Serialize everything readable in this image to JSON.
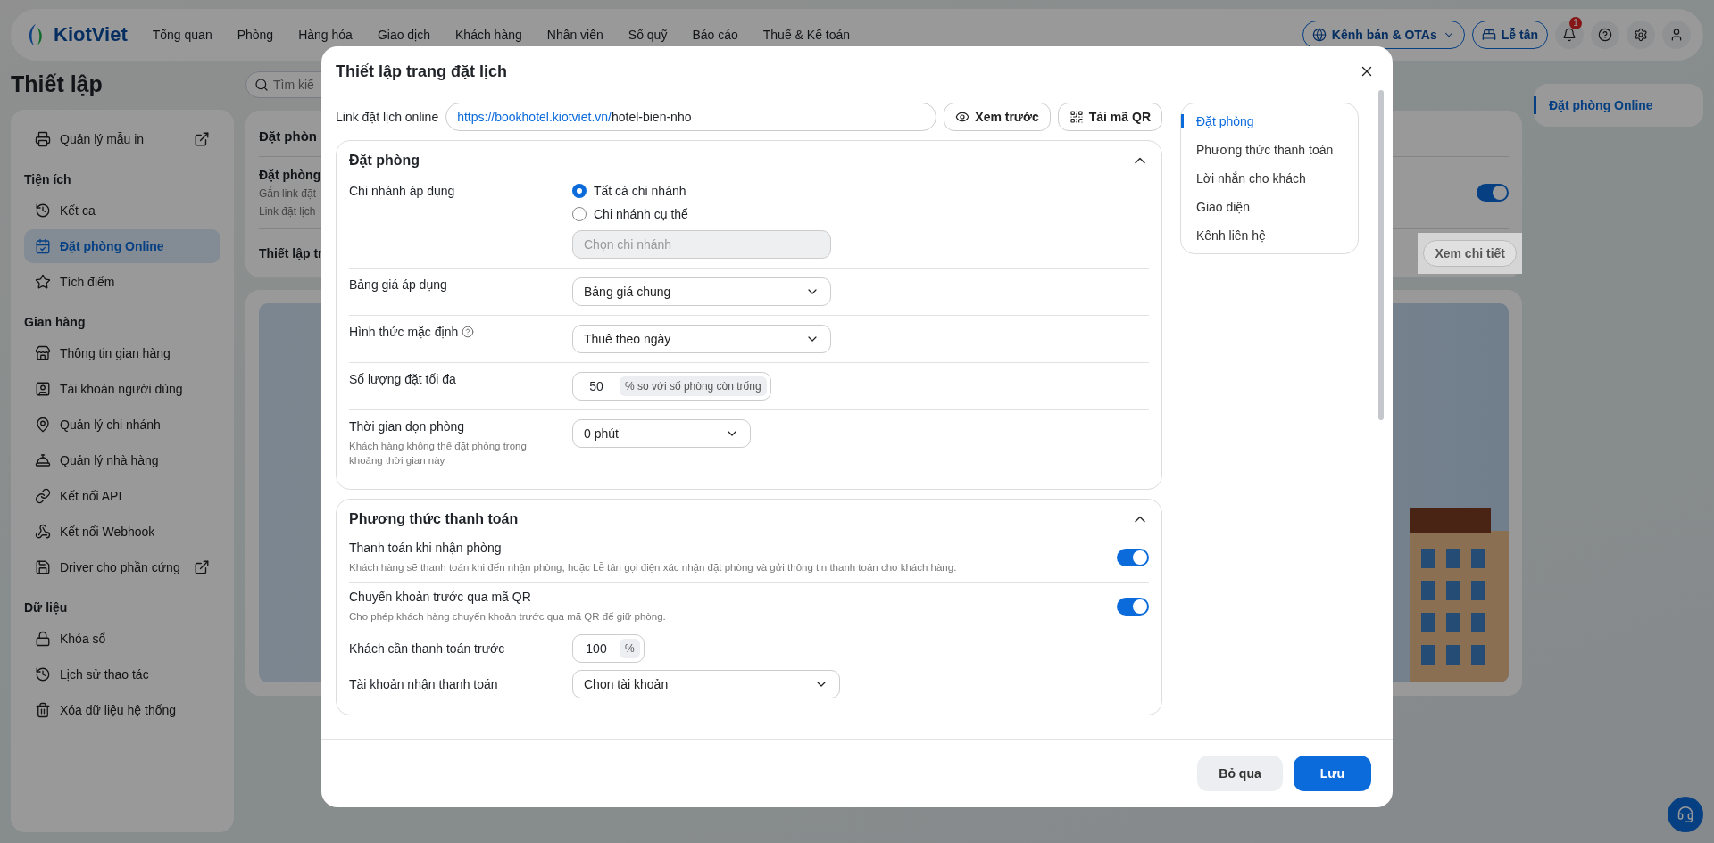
{
  "nav": {
    "logo": "KiotViet",
    "items": [
      "Tổng quan",
      "Phòng",
      "Hàng hóa",
      "Giao dịch",
      "Khách hàng",
      "Nhân viên",
      "Sổ quỹ",
      "Báo cáo",
      "Thuế & Kế toán"
    ],
    "channel_button": "Kênh bán & OTAs",
    "reception_button": "Lễ tân",
    "notification_count": "1"
  },
  "page": {
    "title": "Thiết lập",
    "search_placeholder": "Tìm kiế"
  },
  "sidebar": {
    "sections": [
      {
        "items": [
          {
            "label": "Quản lý mẫu in",
            "selected": false,
            "external": true
          }
        ]
      },
      {
        "heading": "Tiện ích",
        "items": [
          {
            "label": "Kết ca",
            "selected": false,
            "external": false
          },
          {
            "label": "Đặt phòng Online",
            "selected": true,
            "external": false
          },
          {
            "label": "Tích điểm",
            "selected": false,
            "external": false
          }
        ]
      },
      {
        "heading": "Gian hàng",
        "items": [
          {
            "label": "Thông tin gian hàng",
            "selected": false,
            "external": false
          },
          {
            "label": "Tài khoản người dùng",
            "selected": false,
            "external": false
          },
          {
            "label": "Quản lý chi nhánh",
            "selected": false,
            "external": false
          },
          {
            "label": "Quản lý nhà hàng",
            "selected": false,
            "external": false
          },
          {
            "label": "Kết nối API",
            "selected": false,
            "external": false
          },
          {
            "label": "Kết nối Webhook",
            "selected": false,
            "external": false
          },
          {
            "label": "Driver cho phần cứng",
            "selected": false,
            "external": true
          }
        ]
      },
      {
        "heading": "Dữ liệu",
        "items": [
          {
            "label": "Khóa sổ",
            "selected": false,
            "external": false
          },
          {
            "label": "Lịch sử thao tác",
            "selected": false,
            "external": false
          },
          {
            "label": "Xóa dữ liệu hệ thống",
            "selected": false,
            "external": false
          }
        ]
      }
    ]
  },
  "settings_card": {
    "title": "Đặt phòn",
    "booking_title": "Đặt phòng",
    "booking_desc_1": "Gắn link đặt",
    "booking_desc_2": "Link đặt lịch",
    "booking_on": true,
    "setup_label": "Thiết lập tr",
    "detail_button": "Xem chi tiết"
  },
  "right_panel": {
    "items": [
      {
        "label": "Đặt phòng Online",
        "selected": true
      }
    ]
  },
  "modal": {
    "title": "Thiết lập trang đặt lịch",
    "link": {
      "label": "Link đặt lịch online",
      "base": "https://bookhotel.kiotviet.vn/",
      "path": "hotel-bien-nho"
    },
    "preview_button": "Xem trước",
    "qr_button": "Tải mã QR",
    "booking": {
      "title": "Đặt phòng",
      "expanded": true,
      "rows": [
        {
          "kind": "radios",
          "label": "Chi nhánh áp dụng",
          "help": false,
          "options": [
            {
              "label": "Tất cả chi nhánh",
              "selected": true
            },
            {
              "label": "Chi nhánh cụ thể",
              "selected": false
            }
          ],
          "placeholder": "Chọn chi nhánh",
          "disabled": true
        },
        {
          "kind": "select",
          "label": "Bảng giá áp dụng",
          "help": false,
          "value": "Bảng giá chung"
        },
        {
          "kind": "select",
          "label": "Hình thức mặc định",
          "help": true,
          "value": "Thuê theo ngày"
        },
        {
          "kind": "number",
          "label": "Số lượng đặt tối đa",
          "help": false,
          "value": "50",
          "suffix": "% so với số phòng còn trống"
        },
        {
          "kind": "select",
          "label": "Thời gian dọn phòng",
          "help": false,
          "description": "Khách hàng không thể đặt phòng trong khoảng thời gian này",
          "value": "0 phút"
        }
      ]
    },
    "payment": {
      "title": "Phương thức thanh toán",
      "expanded": true,
      "toggles": [
        {
          "label": "Thanh toán khi nhận phòng",
          "description": "Khách hàng sẽ thanh toán khi đến nhận phòng, hoặc Lễ tân gọi điện xác nhận đặt phòng và gửi thông tin thanh toán cho khách hàng.",
          "on": true
        },
        {
          "label": "Chuyển khoản trước qua mã QR",
          "description": "Cho phép khách hàng chuyển khoản trước qua mã QR để giữ phòng.",
          "on": true
        }
      ],
      "fields": [
        {
          "kind": "number",
          "label": "Khách cần thanh toán trước",
          "value": "100",
          "suffix": "%"
        },
        {
          "kind": "select",
          "label": "Tài khoản nhận thanh toán",
          "value": "Chọn tài khoản"
        }
      ]
    },
    "side_nav": [
      {
        "label": "Đặt phòng",
        "selected": true
      },
      {
        "label": "Phương thức thanh toán",
        "selected": false
      },
      {
        "label": "Lời nhắn cho khách",
        "selected": false
      },
      {
        "label": "Giao diện",
        "selected": false
      },
      {
        "label": "Kênh liên hệ",
        "selected": false
      }
    ],
    "cancel_button": "Bỏ qua",
    "save_button": "Lưu"
  }
}
